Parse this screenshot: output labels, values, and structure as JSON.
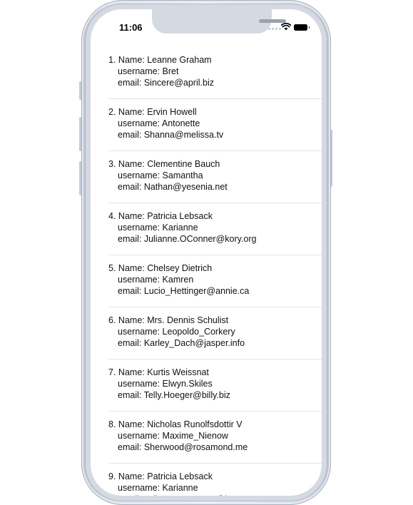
{
  "status_bar": {
    "time": "11:06"
  },
  "labels": {
    "name": "Name:",
    "username": "username:",
    "email": "email:"
  },
  "users": [
    {
      "index": "1.",
      "name": "Leanne Graham",
      "username": "Bret",
      "email": "Sincere@april.biz"
    },
    {
      "index": "2.",
      "name": "Ervin Howell",
      "username": "Antonette",
      "email": "Shanna@melissa.tv"
    },
    {
      "index": "3.",
      "name": "Clementine Bauch",
      "username": "Samantha",
      "email": "Nathan@yesenia.net"
    },
    {
      "index": "4.",
      "name": "Patricia Lebsack",
      "username": "Karianne",
      "email": "Julianne.OConner@kory.org"
    },
    {
      "index": "5.",
      "name": "Chelsey Dietrich",
      "username": "Kamren",
      "email": "Lucio_Hettinger@annie.ca"
    },
    {
      "index": "6.",
      "name": "Mrs. Dennis Schulist",
      "username": "Leopoldo_Corkery",
      "email": "Karley_Dach@jasper.info"
    },
    {
      "index": "7.",
      "name": "Kurtis Weissnat",
      "username": "Elwyn.Skiles",
      "email": "Telly.Hoeger@billy.biz"
    },
    {
      "index": "8.",
      "name": "Nicholas Runolfsdottir V",
      "username": "Maxime_Nienow",
      "email": "Sherwood@rosamond.me"
    },
    {
      "index": "9.",
      "name": "Patricia Lebsack",
      "username": "Karianne",
      "email": "Julianne.OConner@kory.org"
    }
  ]
}
